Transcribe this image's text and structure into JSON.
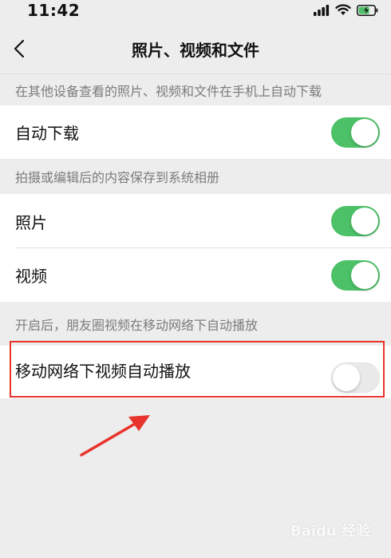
{
  "status_bar": {
    "time": "11:42"
  },
  "nav": {
    "title": "照片、视频和文件"
  },
  "sections": [
    {
      "header": "在其他设备查看的照片、视频和文件在手机上自动下载",
      "items": [
        {
          "label": "自动下载",
          "enabled": true
        }
      ]
    },
    {
      "header": "拍摄或编辑后的内容保存到系统相册",
      "items": [
        {
          "label": "照片",
          "enabled": true
        },
        {
          "label": "视频",
          "enabled": true
        }
      ]
    },
    {
      "header": "开启后，朋友圈视频在移动网络下自动播放",
      "items": [
        {
          "label": "移动网络下视频自动播放",
          "enabled": false
        }
      ]
    }
  ],
  "watermark": "Baidu 经验",
  "colors": {
    "toggle_on": "#4cc167",
    "highlight": "#e8342d"
  }
}
